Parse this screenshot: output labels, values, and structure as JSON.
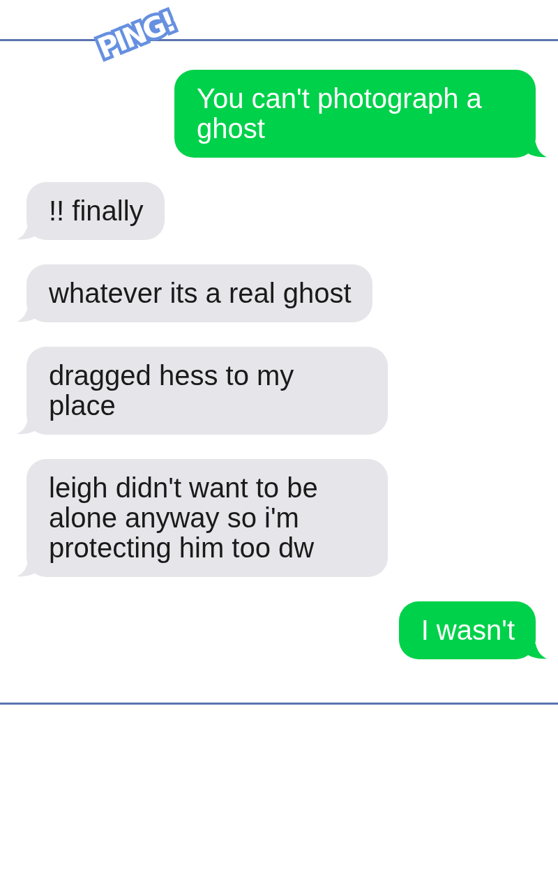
{
  "sticker": {
    "text": "PING!"
  },
  "messages": [
    {
      "kind": "sent",
      "text": "You can't photograph a ghost"
    },
    {
      "kind": "received",
      "text": "!! finally"
    },
    {
      "kind": "received",
      "text": "whatever its a real ghost"
    },
    {
      "kind": "received",
      "text": "dragged hess to my place"
    },
    {
      "kind": "received",
      "text": "leigh didn't want to be alone anyway so i'm protecting him too dw"
    },
    {
      "kind": "sent",
      "text": "I wasn't"
    }
  ]
}
